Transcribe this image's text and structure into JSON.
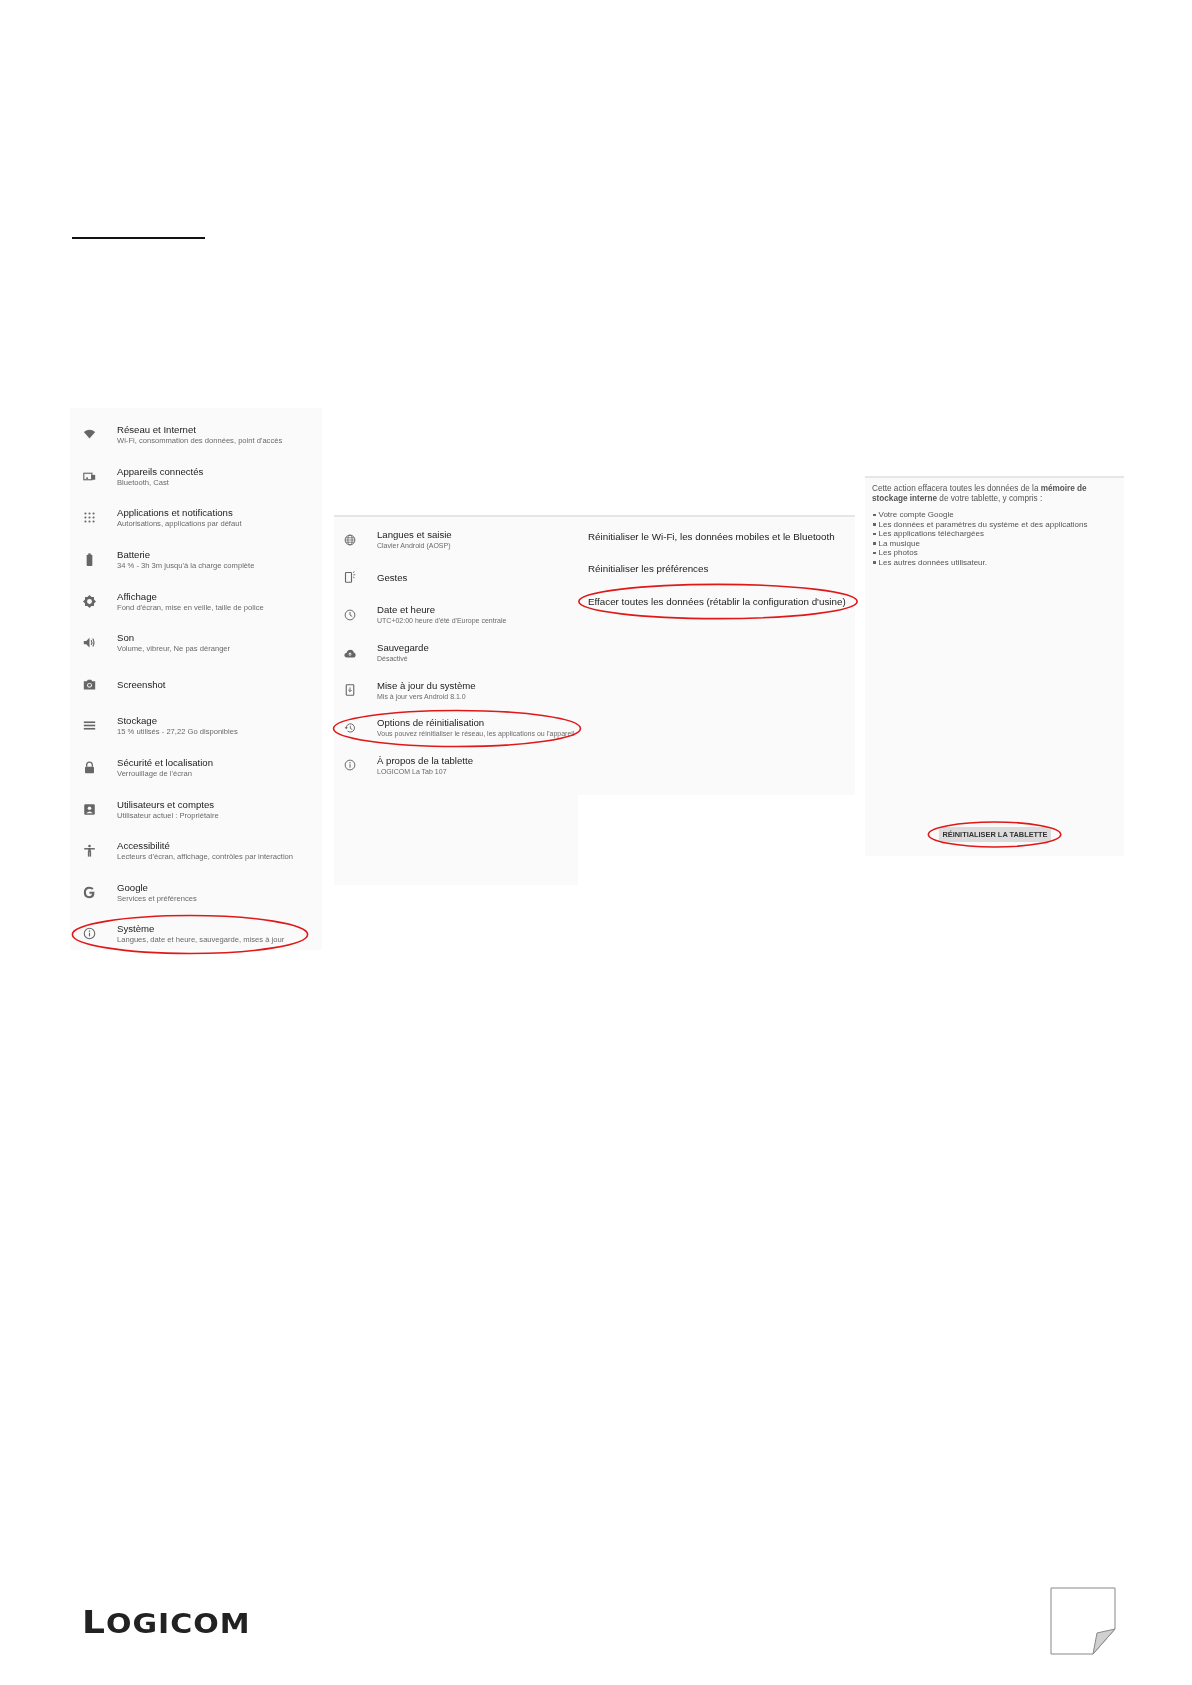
{
  "settings_main": {
    "items": [
      {
        "title": "Réseau et Internet",
        "subtitle": "Wi-Fi, consommation des données, point d'accès",
        "circled": false
      },
      {
        "title": "Appareils connectés",
        "subtitle": "Bluetooth, Cast",
        "circled": false
      },
      {
        "title": "Applications et notifications",
        "subtitle": "Autorisations, applications par défaut",
        "circled": false
      },
      {
        "title": "Batterie",
        "subtitle": "34 % - 3h 3m jusqu'à la charge complète",
        "circled": false
      },
      {
        "title": "Affichage",
        "subtitle": "Fond d'écran, mise en veille, taille de police",
        "circled": false
      },
      {
        "title": "Son",
        "subtitle": "Volume, vibreur, Ne pas déranger",
        "circled": false
      },
      {
        "title": "Screenshot",
        "circled": false
      },
      {
        "title": "Stockage",
        "subtitle": "15 % utilisés - 27,22 Go disponibles",
        "circled": false
      },
      {
        "title": "Sécurité et localisation",
        "subtitle": "Verrouillage de l'écran",
        "circled": false
      },
      {
        "title": "Utilisateurs et comptes",
        "subtitle": "Utilisateur actuel : Propriétaire",
        "circled": false
      },
      {
        "title": "Accessibilité",
        "subtitle": "Lecteurs d'écran, affichage, contrôles par interaction",
        "circled": false
      },
      {
        "title": "Google",
        "subtitle": "Services et préférences",
        "circled": false
      },
      {
        "title": "Système",
        "subtitle": "Langues, date et heure, sauvegarde, mises à jour",
        "circled": true
      }
    ]
  },
  "settings_system": {
    "items": [
      {
        "title": "Langues et saisie",
        "subtitle": "Clavier Android (AOSP)",
        "circled": false
      },
      {
        "title": "Gestes",
        "circled": false
      },
      {
        "title": "Date et heure",
        "subtitle": "UTC+02:00 heure d'été d'Europe centrale",
        "circled": false
      },
      {
        "title": "Sauvegarde",
        "subtitle": "Désactivé",
        "circled": false
      },
      {
        "title": "Mise à jour du système",
        "subtitle": "Mis à jour vers Android 8.1.0",
        "circled": false
      },
      {
        "title": "Options de réinitialisation",
        "subtitle": "Vous pouvez réinitialiser le réseau, les applications ou l'appareil",
        "circled": true
      },
      {
        "title": "À propos de la tablette",
        "subtitle": "LOGICOM La Tab 107",
        "circled": false
      }
    ]
  },
  "reset_options": {
    "items": [
      {
        "title": "Réinitialiser le Wi-Fi, les données mobiles et le Bluetooth",
        "circled": false
      },
      {
        "title": "Réinitialiser les préférences",
        "circled": false
      },
      {
        "title": "Effacer toutes les données (rétablir la configuration d'usine)",
        "circled": true
      }
    ]
  },
  "erase_confirm": {
    "message": "Cette action effacera toutes les données de la **mémoire de stockage interne** de votre tablette, y compris :",
    "list": [
      "Votre compte Google",
      "Les données et paramètres du système et des applications",
      "Les applications téléchargées",
      "La musique",
      "Les photos",
      "Les autres données utilisateur."
    ],
    "button": {
      "label": "RÉINITIALISER LA TABLETTE",
      "circled": true
    }
  },
  "footer": {
    "logo": "LOGICOM"
  }
}
